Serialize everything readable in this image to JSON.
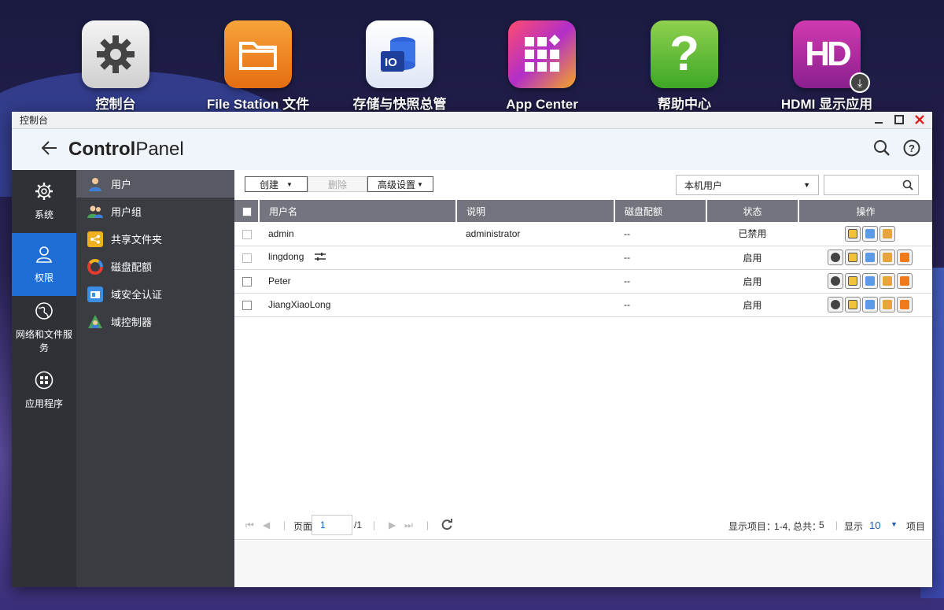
{
  "desktop": {
    "icons": [
      {
        "label": "控制台",
        "icon": "gear-icon"
      },
      {
        "label": "File Station 文件\n总管",
        "icon": "folder-icon"
      },
      {
        "label": "存储与快照总管",
        "icon": "storage-icon"
      },
      {
        "label": "App Center",
        "icon": "app-grid-icon"
      },
      {
        "label": "帮助中心",
        "icon": "help-icon"
      },
      {
        "label": "HDMI 显示应用\n程序",
        "icon": "hdmi-icon"
      }
    ]
  },
  "window": {
    "title": "控制台",
    "app_title_bold": "Control",
    "app_title_rest": "Panel",
    "accent": "#1f6ed6"
  },
  "nav1": [
    {
      "label": "系统",
      "icon": "gear-icon"
    },
    {
      "label": "权限",
      "icon": "user-icon",
      "active": true
    },
    {
      "label": "网络和文件服务",
      "icon": "globe-icon"
    },
    {
      "label": "应用程序",
      "icon": "apps-icon"
    }
  ],
  "nav2": [
    {
      "label": "用户",
      "icon": "user-icon",
      "active": true
    },
    {
      "label": "用户组",
      "icon": "user-group-icon"
    },
    {
      "label": "共享文件夹",
      "icon": "shared-folder-icon"
    },
    {
      "label": "磁盘配额",
      "icon": "quota-icon"
    },
    {
      "label": "域安全认证",
      "icon": "domain-auth-icon"
    },
    {
      "label": "域控制器",
      "icon": "domain-controller-icon"
    }
  ],
  "toolbar": {
    "create_label": "创建",
    "delete_label": "删除",
    "advanced_label": "高级设置",
    "scope_value": "本机用户",
    "search_placeholder": ""
  },
  "table": {
    "headers": [
      "用户名",
      "说明",
      "磁盘配额",
      "状态",
      "操作"
    ],
    "rows": [
      {
        "name": "admin",
        "desc": "administrator",
        "quota": "--",
        "status": "已禁用",
        "disabled": true
      },
      {
        "name": "lingdong",
        "desc": "",
        "quota": "--",
        "status": "启用",
        "disabled": false
      },
      {
        "name": "Peter",
        "desc": "",
        "quota": "--",
        "status": "启用",
        "disabled": false
      },
      {
        "name": "JiangXiaoLong",
        "desc": "",
        "quota": "--",
        "status": "启用",
        "disabled": false
      }
    ]
  },
  "pager": {
    "page_label": "页面",
    "page_value": "1",
    "page_total": "/1",
    "summary_label": "显示项目：",
    "summary_range": "1-4, 总共：",
    "summary_total": "5",
    "show_label": "显示",
    "show_value": "10",
    "items_label": "项目"
  }
}
